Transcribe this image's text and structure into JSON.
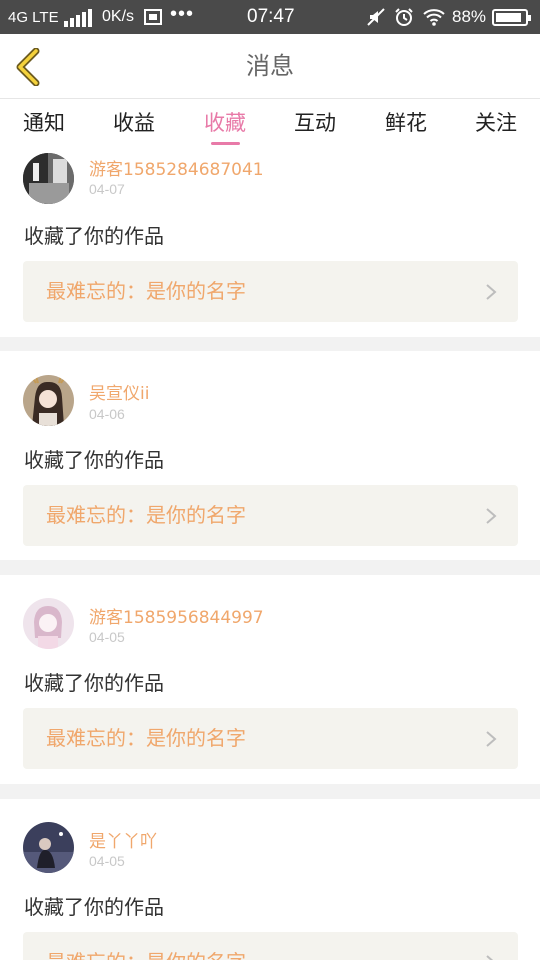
{
  "status_bar": {
    "network": "4G LTE",
    "speed": "0K/s",
    "time": "07:47",
    "battery_text": "88%",
    "battery_level": 0.88,
    "icons": [
      "signal-icon",
      "notification-icon",
      "more-dots-icon",
      "mute-icon",
      "alarm-icon",
      "wifi-icon",
      "battery-icon"
    ]
  },
  "header": {
    "title": "消息",
    "back_icon": "chevron-left-icon",
    "accent_color": "#e87aa8"
  },
  "tabs": [
    {
      "label": "通知"
    },
    {
      "label": "收益"
    },
    {
      "label": "收藏",
      "active": true
    },
    {
      "label": "互动"
    },
    {
      "label": "鲜花"
    },
    {
      "label": "关注"
    }
  ],
  "feed": [
    {
      "user": "游客1585284687041",
      "date": "04-07",
      "action": "收藏了你的作品",
      "work": "最难忘的：是你的名字"
    },
    {
      "user": "吴宣仪ii",
      "date": "04-06",
      "action": "收藏了你的作品",
      "work": "最难忘的：是你的名字"
    },
    {
      "user": "游客1585956844997",
      "date": "04-05",
      "action": "收藏了你的作品",
      "work": "最难忘的：是你的名字"
    },
    {
      "user": "是丫丫吖",
      "date": "04-05",
      "action": "收藏了你的作品",
      "work": "最难忘的：是你的名字"
    }
  ]
}
